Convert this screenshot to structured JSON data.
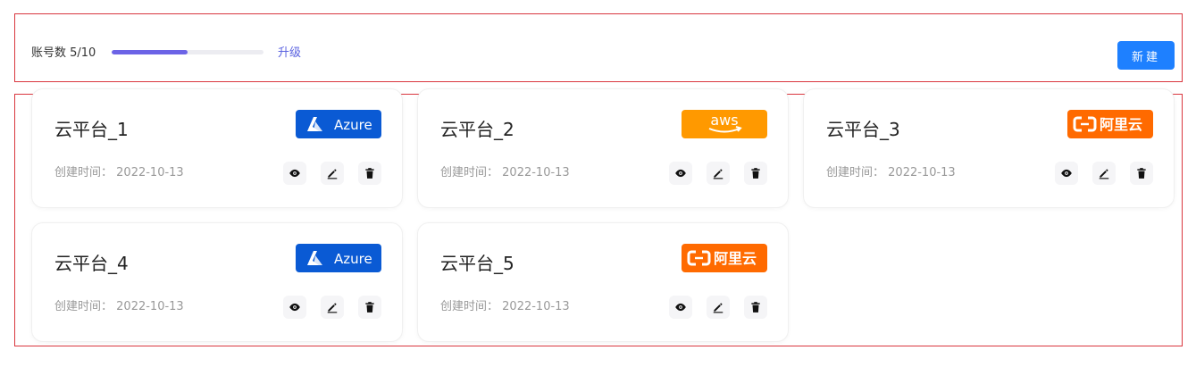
{
  "header": {
    "quota_label": "账号数 5/10",
    "quota_used": 5,
    "quota_total": 10,
    "upgrade_label": "升级",
    "new_button_label": "新建",
    "accent_color": "#6c63e6",
    "primary_color": "#1e80ff"
  },
  "cards": [
    {
      "title": "云平台_1",
      "date_label": "创建时间：",
      "date": "2022-10-13",
      "provider": "Azure",
      "logo_text": "Azure"
    },
    {
      "title": "云平台_2",
      "date_label": "创建时间：",
      "date": "2022-10-13",
      "provider": "AWS",
      "logo_text": "aws"
    },
    {
      "title": "云平台_3",
      "date_label": "创建时间：",
      "date": "2022-10-13",
      "provider": "Aliyun",
      "logo_text": "阿里云"
    },
    {
      "title": "云平台_4",
      "date_label": "创建时间：",
      "date": "2022-10-13",
      "provider": "Azure",
      "logo_text": "Azure"
    },
    {
      "title": "云平台_5",
      "date_label": "创建时间：",
      "date": "2022-10-13",
      "provider": "Aliyun",
      "logo_text": "阿里云"
    }
  ],
  "icons": {
    "view": "eye-icon",
    "edit": "pencil-icon",
    "delete": "trash-icon"
  },
  "provider_colors": {
    "Azure": "#0a5ad4",
    "AWS": "#ff9900",
    "Aliyun": "#ff6a00"
  }
}
